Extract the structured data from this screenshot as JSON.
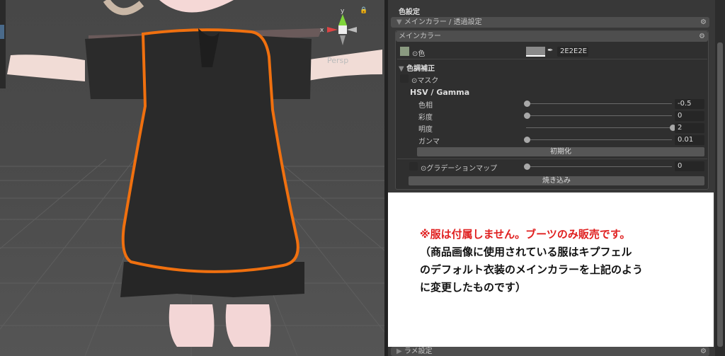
{
  "scene": {
    "gizmo_x": "x",
    "gizmo_y": "y",
    "projection": "Persp",
    "lock_icon": "lock-icon"
  },
  "inspector": {
    "section_title": "色設定",
    "foldout": "メインカラー / 透過設定",
    "main_color": {
      "header": "メインカラー",
      "color_label": "⊙色",
      "hex_value": "2E2E2E",
      "swatch_color": "#8a8a8a",
      "tone_correction": "色調補正",
      "mask_label": "⊙マスク",
      "hsv_title": "HSV / Gamma",
      "sliders": [
        {
          "label": "色相",
          "value": "-0.5",
          "fraction": 0.0
        },
        {
          "label": "彩度",
          "value": "0",
          "fraction": 0.0
        },
        {
          "label": "明度",
          "value": "2",
          "fraction": 1.0
        },
        {
          "label": "ガンマ",
          "value": "0.01",
          "fraction": 0.0
        }
      ],
      "reset_button": "初期化",
      "gradient_map": {
        "label": "⊙グラデーションマップ",
        "value": "0",
        "fraction": 0.0
      },
      "bake_button": "焼き込み"
    },
    "bottom_foldout": "ラメ設定"
  },
  "notice": {
    "line1": "※服は付属しません。ブーツのみ販売です。",
    "line2": "（商品画像に使用されている服はキプフェル",
    "line3": "のデフォルト衣装のメインカラーを上記のよう",
    "line4": "に変更したものです）"
  }
}
